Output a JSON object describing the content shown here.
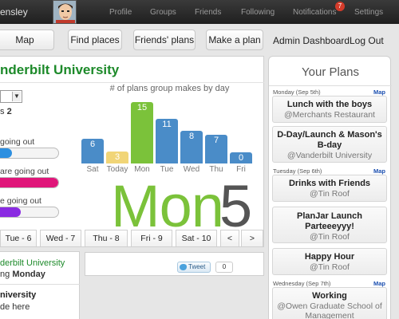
{
  "topbar": {
    "username": "ensley",
    "nav": [
      "Profile",
      "Groups",
      "Friends",
      "Following",
      "Notifications",
      "Settings"
    ],
    "notification_count": "7"
  },
  "toolbar": {
    "map": "Map",
    "find_places": "Find places",
    "friends_plans": "Friends' plans",
    "make_plan": "Make a plan",
    "admin_dashboard": "Admin Dashboard",
    "logout": "Log Out"
  },
  "main": {
    "university": "nderbilt University",
    "stat_prefix": "s",
    "stat_value": "2",
    "bars": [
      {
        "label": "going out",
        "fraction": 0.2,
        "color": "#2d8fe0"
      },
      {
        "label": "are going out",
        "fraction": 1.0,
        "color": "#e0167a"
      },
      {
        "label": "e going out",
        "fraction": 0.35,
        "color": "#8a2be2"
      }
    ],
    "big_day": "Mon",
    "big_number": "5"
  },
  "chart_data": {
    "type": "bar",
    "title": "# of plans group makes by day",
    "categories": [
      "Sat",
      "Today",
      "Mon",
      "Tue",
      "Wed",
      "Thu",
      "Fri"
    ],
    "values": [
      6,
      3,
      15,
      11,
      8,
      7,
      0
    ],
    "colors": [
      "#4a8cc8",
      "#f1d577",
      "#7bc23a",
      "#4a8cc8",
      "#4a8cc8",
      "#4a8cc8",
      "#4a8cc8"
    ],
    "ylim": [
      0,
      15
    ],
    "grid": false
  },
  "daytabs": [
    "Tue - 6",
    "Wed - 7",
    "Thu - 8",
    "Fri - 9",
    "Sat - 10",
    "<",
    ">"
  ],
  "bottom_left": {
    "line1": "derbilt University",
    "line2_prefix": "ng",
    "line2_bold": "Monday",
    "line3": "niversity",
    "line4": "de here"
  },
  "social": {
    "tweet_label": "Tweet",
    "tweet_count": "0"
  },
  "plans": {
    "title": "Your Plans",
    "map_label": "Map",
    "groups": [
      {
        "day": "Monday (Sep 5th)",
        "items": [
          {
            "name": "Lunch with the boys",
            "location": "@Merchants Restaurant"
          },
          {
            "name": "D-Day/Launch & Mason's B-day",
            "location": "@Vanderbilt University"
          }
        ]
      },
      {
        "day": "Tuesday (Sep 6th)",
        "items": [
          {
            "name": "Drinks with Friends",
            "location": "@Tin Roof"
          },
          {
            "name": "PlanJar Launch Parteeeyyy!",
            "location": "@Tin Roof"
          },
          {
            "name": "Happy Hour",
            "location": "@Tin Roof"
          }
        ]
      },
      {
        "day": "Wednesday (Sep 7th)",
        "items": [
          {
            "name": "Working",
            "location": "@Owen Graduate School of Management"
          }
        ]
      }
    ]
  }
}
